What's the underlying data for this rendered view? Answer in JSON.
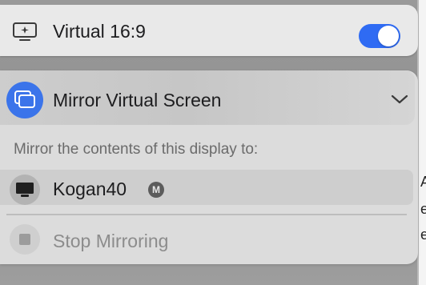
{
  "display": {
    "name": "Virtual 16:9",
    "enabled": true,
    "icon": "display-sparkle-icon"
  },
  "mirror": {
    "title": "Mirror Virtual Screen",
    "icon": "mirror-screens-icon",
    "expand_icon": "chevron-down-icon",
    "section_label": "Mirror the contents of this display to:",
    "targets": [
      {
        "name": "Kogan40",
        "badge": "M",
        "icon": "monitor-icon"
      }
    ],
    "stop": {
      "label": "Stop Mirroring",
      "icon": "stop-icon"
    }
  },
  "colors": {
    "accent": "#2f6bf3",
    "mirror_icon_bg": "#3b74ea"
  }
}
